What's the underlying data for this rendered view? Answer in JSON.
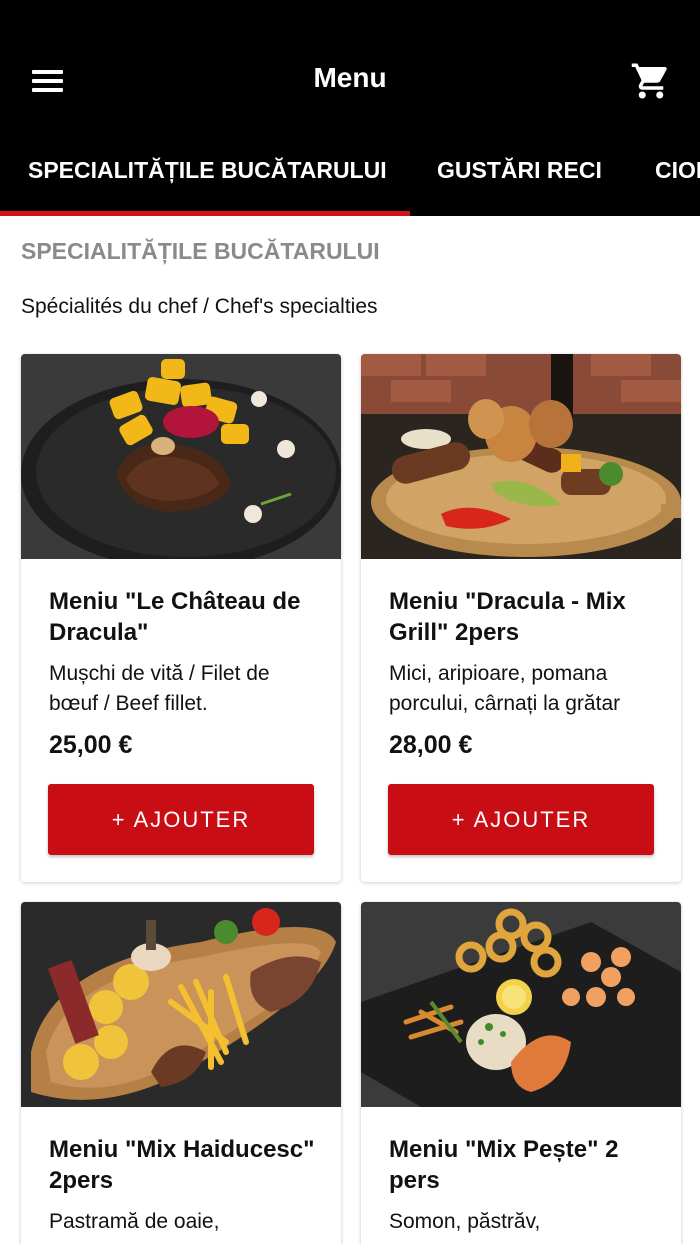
{
  "header": {
    "title": "Menu",
    "menu_icon": "hamburger-menu-icon",
    "cart_icon": "shopping-cart-icon"
  },
  "tabs": [
    {
      "label": "SPECIALITĂȚILE BUCĂTARULUI",
      "active": true
    },
    {
      "label": "GUSTĂRI RECI",
      "active": false
    },
    {
      "label": "CIORBE",
      "active": false
    }
  ],
  "section": {
    "title": "SPECIALITĂȚILE BUCĂTARULUI",
    "subtitle": "Spécialités du chef / Chef's specialties"
  },
  "items": [
    {
      "name": "Meniu \"Le Château de Dracula\"",
      "description": "Mușchi de vită / Filet de bœuf / Beef fillet.",
      "price": "25,00 €",
      "button": "+ AJOUTER"
    },
    {
      "name": "Meniu \"Dracula - Mix Grill\" 2pers",
      "description": "Mici, aripioare, pomana porcului, cârnați la grătar",
      "price": "28,00 €",
      "button": "+ AJOUTER"
    },
    {
      "name": "Meniu \"Mix Haiducesc\" 2pers",
      "description": "Pastramă de oaie,",
      "price": "",
      "button": ""
    },
    {
      "name": "Meniu \"Mix Pește\" 2 pers",
      "description": "Somon, păstrăv,",
      "price": "",
      "button": ""
    }
  ],
  "colors": {
    "header_bg": "#000000",
    "accent": "#d0121b",
    "button_bg": "#c80d15",
    "section_title": "#8a8a8a"
  }
}
